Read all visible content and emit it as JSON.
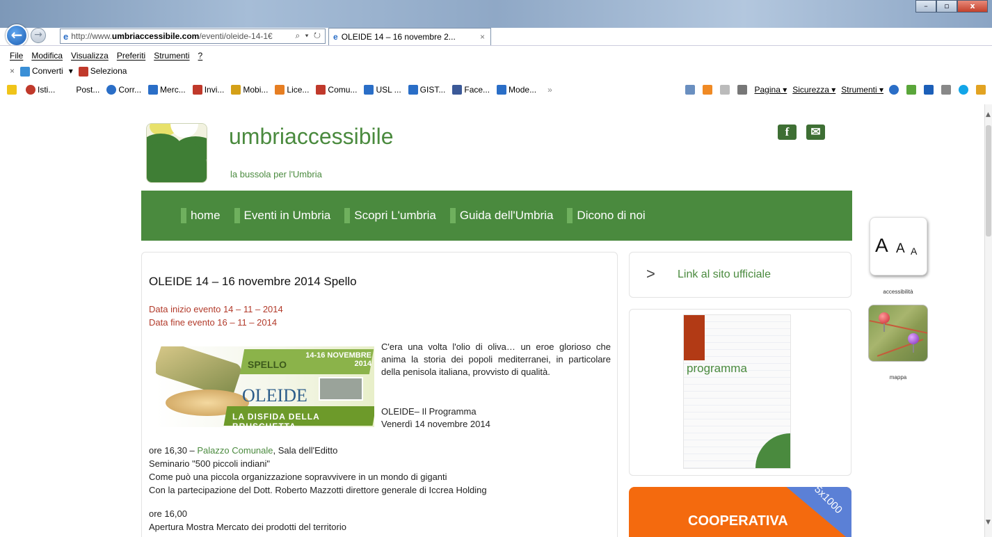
{
  "browser": {
    "url_prefix": "http://www.",
    "url_domain": "umbriaccessibile.com",
    "url_path": "/eventi/oleide-14-1€",
    "url_tools": "⌕ ▾ ↻",
    "tab_title": "OLEIDE 14 – 16 novembre 2...",
    "tab_close": "×",
    "window_min": "–",
    "window_max": "▫",
    "window_close": "x",
    "right_icons": "⌂★⚙",
    "back": "←",
    "forward": "→",
    "ie_glyph": "e"
  },
  "menu": [
    "File",
    "Modifica",
    "Visualizza",
    "Preferiti",
    "Strumenti",
    "?"
  ],
  "convert_bar": {
    "close": "×",
    "convert_label": "Converti",
    "convert_arrow": "▾",
    "select_label": "Seleziona"
  },
  "favorites": [
    {
      "label": "Isti...",
      "color": "#c0392b"
    },
    {
      "label": "Post...",
      "color": "#888888"
    },
    {
      "label": "Corr...",
      "color": "#2a6ec7"
    },
    {
      "label": "Merc...",
      "color": "#2a6ec7"
    },
    {
      "label": "Invi...",
      "color": "#c0392b"
    },
    {
      "label": "Mobi...",
      "color": "#d4a017"
    },
    {
      "label": "Lice...",
      "color": "#e67e22"
    },
    {
      "label": "Comu...",
      "color": "#c0392b"
    },
    {
      "label": "USL ...",
      "color": "#2a6ec7"
    },
    {
      "label": "GIST...",
      "color": "#2a6ec7"
    },
    {
      "label": "Face...",
      "color": "#3b5998"
    },
    {
      "label": "Mode...",
      "color": "#2a6ec7"
    }
  ],
  "favorites_more": "»",
  "command_bar": {
    "pagina": "Pagina ▾",
    "sicurezza": "Sicurezza ▾",
    "strumenti": "Strumenti ▾"
  },
  "site": {
    "name": "umbriaccessibile",
    "tagline": "la bussola per l'Umbria",
    "social_facebook": "f",
    "social_mail": "✉"
  },
  "nav": [
    "home",
    "Eventi in Umbria",
    "Scopri L'umbria",
    "Guida dell'Umbria",
    "Dicono di noi"
  ],
  "accessibility": {
    "a_large": "A",
    "a_medium": "A",
    "a_small": "A",
    "label": "accessibilità",
    "map_label": "mappa"
  },
  "article": {
    "title": "OLEIDE 14 – 16 novembre 2014 Spello",
    "date_start": "Data inizio evento 14 – 11 – 2014",
    "date_end": "Data  fine evento 16 – 11 – 2014",
    "intro": "C'era una volta l'olio di oliva… un eroe glorioso che anima la storia dei popoli mediterranei, in particolare della penisola italiana, provvisto di qualità.",
    "program_title": "OLEIDE– Il Programma",
    "program_day": "Venerdì 14 novembre 2014",
    "banner": {
      "spello": "SPELLO",
      "dates": "14-16 NOVEMBRE 2014",
      "oleide": "OLEIDE",
      "disfida": "LA DISFIDA DELLA BRUSCHETTA"
    },
    "line1_prefix": "ore 16,30 – ",
    "line1_link": "Palazzo Comunale",
    "line1_suffix": ", Sala dell'Editto",
    "line2": "Seminario \"500 piccoli indiani\"",
    "line3": "Come può una piccola organizzazione sopravvivere in un mondo di giganti",
    "line4": "Con la partecipazione del Dott. Roberto Mazzotti direttore generale di Iccrea Holding",
    "line5": "ore 16,00",
    "line6": "Apertura Mostra Mercato dei prodotti del territorio"
  },
  "sidebar": {
    "official_chevron": ">",
    "official_link": "Link al sito ufficiale",
    "programma": "programma",
    "coop": "COOPERATIVA",
    "coop_badge": "5x1000"
  },
  "colors": {
    "brand_green": "#4a8a3e",
    "date_red": "#b23a2a",
    "coop_orange": "#f46a0e"
  }
}
